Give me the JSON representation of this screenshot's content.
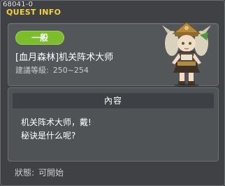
{
  "quest_id": "68041-0",
  "window_title": "QUEST INFO",
  "quest": {
    "type_badge": "一般",
    "name": "[血月森林]机关阵术大师",
    "level_label": "建議等級:",
    "level_range": "250~254"
  },
  "content": {
    "header": "內容",
    "lines": [
      "机关阵术大师，戴!",
      "秘诀是什么呢?"
    ]
  },
  "status": {
    "label": "狀態:",
    "value": "可開始"
  },
  "colors": {
    "title": "#f6d23a",
    "badge": "#7cbd2c",
    "panel": "#54575a",
    "background": "#3f4144"
  }
}
